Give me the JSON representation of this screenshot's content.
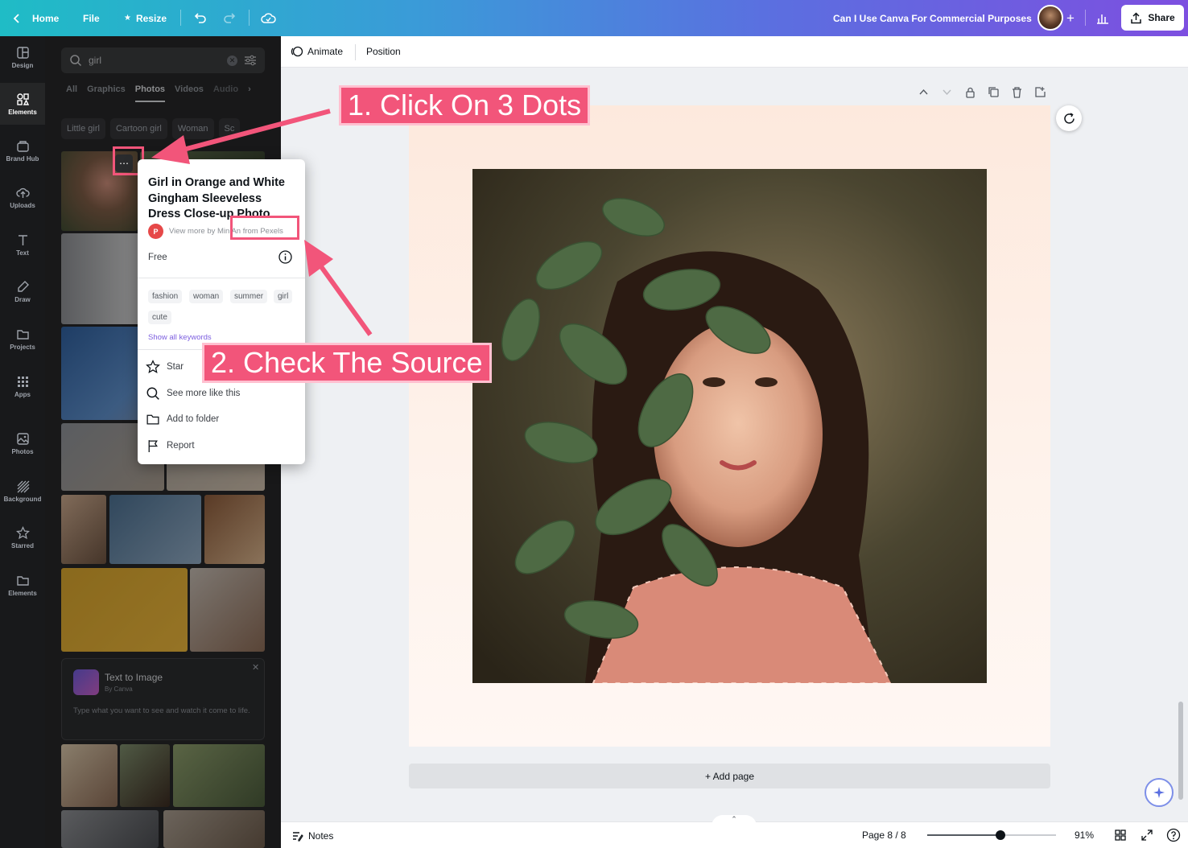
{
  "topbar": {
    "home": "Home",
    "file": "File",
    "resize": "Resize",
    "doc_title": "Can I Use Canva For Commercial Purposes",
    "share": "Share"
  },
  "rail": [
    {
      "label": "Design",
      "icon": "layout-icon"
    },
    {
      "label": "Elements",
      "icon": "shapes-icon"
    },
    {
      "label": "Brand Hub",
      "icon": "brand-icon"
    },
    {
      "label": "Uploads",
      "icon": "cloud-upload-icon"
    },
    {
      "label": "Text",
      "icon": "text-icon"
    },
    {
      "label": "Draw",
      "icon": "pen-icon"
    },
    {
      "label": "Projects",
      "icon": "folder-icon"
    },
    {
      "label": "Apps",
      "icon": "grid-icon"
    },
    {
      "label": "Photos",
      "icon": "image-icon"
    },
    {
      "label": "Background",
      "icon": "hatch-icon"
    },
    {
      "label": "Starred",
      "icon": "star-icon"
    },
    {
      "label": "Elements",
      "icon": "folder-icon"
    }
  ],
  "panel": {
    "search_value": "girl",
    "tabs": [
      "All",
      "Graphics",
      "Photos",
      "Videos",
      "Audio"
    ],
    "active_tab": "Photos",
    "chips": [
      "Little girl",
      "Cartoon girl",
      "Woman",
      "Sc"
    ],
    "tti_title": "Text to Image",
    "tti_by": "By Canva",
    "tti_desc": "Type what you want to see and watch it come to life."
  },
  "menu": {
    "title": "Girl in Orange and White Gingham Sleeveless Dress Close-up Photo",
    "attribution": "View more by Min An from Pexels",
    "license": "Free",
    "keywords": [
      "fashion",
      "woman",
      "summer",
      "girl",
      "cute"
    ],
    "show_all": "Show all keywords",
    "actions": [
      "Star",
      "See more like this",
      "Add to folder",
      "Report"
    ]
  },
  "callouts": {
    "step1": "1. Click On 3 Dots",
    "step2": "2. Check The Source"
  },
  "editor": {
    "animate": "Animate",
    "position": "Position",
    "add_page": "+ Add page",
    "notes": "Notes",
    "page_indicator": "Page 8 / 8",
    "zoom": "91%"
  },
  "colors": {
    "accent_pink": "#f2557a",
    "panel_bg": "#252627",
    "rail_bg": "#18191b"
  }
}
